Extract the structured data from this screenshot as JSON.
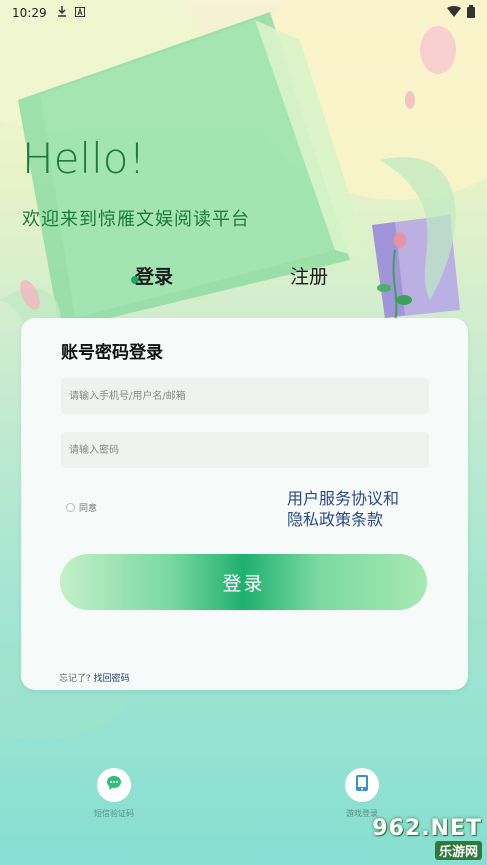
{
  "status_bar": {
    "time": "10:29",
    "download_icon": "download-icon",
    "app_icon": "a-icon",
    "wifi_icon": "wifi-icon",
    "battery_icon": "battery-icon"
  },
  "hero": {
    "hello": "Hello!",
    "welcome": "欢迎来到惊雁文娱阅读平台"
  },
  "tabs": {
    "login": "登录",
    "register": "注册"
  },
  "card": {
    "title": "账号密码登录",
    "account_placeholder": "请输入手机号/用户名/邮箱",
    "password_placeholder": "请输入密码",
    "agree_label": "同意",
    "policy_user": "用户服务协议",
    "policy_and": "和",
    "policy_privacy": "隐私政策条款",
    "login_button": "登录",
    "forgot_prefix": "忘记了?",
    "forgot_link": "找回密码"
  },
  "bottom": {
    "sms_label": "短信验证码",
    "other_label": "游戏登录"
  },
  "watermark": {
    "top": "962.NET",
    "bottom": "乐游网"
  },
  "colors": {
    "accent_green": "#1fb070",
    "title_green": "#1e7a3c",
    "link_blue": "#2b4a8b"
  }
}
